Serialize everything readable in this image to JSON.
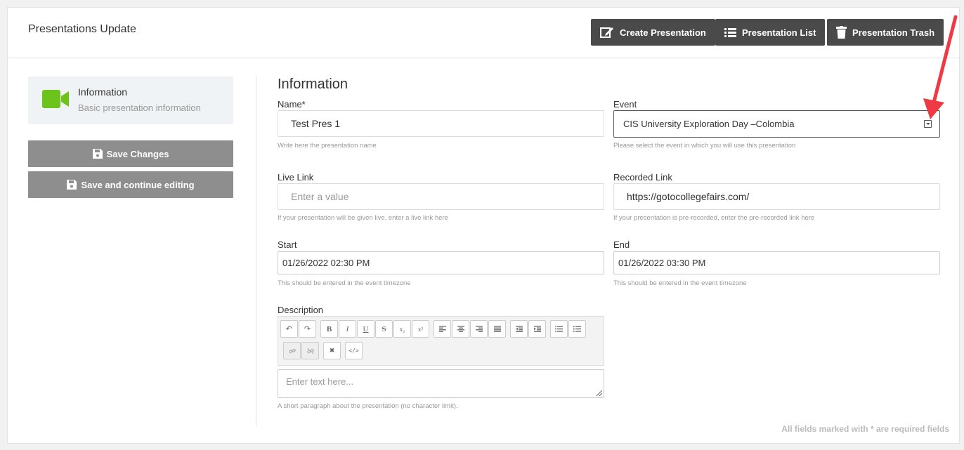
{
  "header": {
    "title": "Presentations Update",
    "buttons": {
      "create": "Create Presentation",
      "list": "Presentation List",
      "trash": "Presentation Trash"
    }
  },
  "sidebar": {
    "card_title": "Information",
    "card_subtitle": "Basic presentation information",
    "save_changes": "Save Changes",
    "save_continue": "Save and continue editing"
  },
  "form": {
    "section_title": "Information",
    "name": {
      "label": "Name*",
      "value": "Test Pres 1",
      "help": "Write here the presentation name"
    },
    "event": {
      "label": "Event",
      "value": "CIS University Exploration Day –Colombia",
      "help": "Please select the event in which you will use this presentation"
    },
    "live_link": {
      "label": "Live Link",
      "placeholder": "Enter a value",
      "help": "If your presentation will be given live, enter a live link here"
    },
    "recorded_link": {
      "label": "Recorded Link",
      "value": "https://gotocollegefairs.com/",
      "help": "If your presentation is pre-recorded, enter the pre-recorded link here"
    },
    "start": {
      "label": "Start",
      "value": "01/26/2022 02:30 PM",
      "help": "This should be entered in the event timezone"
    },
    "end": {
      "label": "End",
      "value": "01/26/2022 03:30 PM",
      "help": "This should be entered in the event timezone"
    },
    "description": {
      "label": "Description",
      "placeholder": "Enter text here...",
      "help": "A short paragraph about the presentation (no character limit)."
    }
  },
  "toolbar": {
    "undo": "↶",
    "redo": "↷",
    "bold": "B",
    "italic": "I",
    "underline": "U",
    "strike": "S",
    "subscript": "x₂",
    "superscript": "x²",
    "remove_format": "✖",
    "code": "</>"
  },
  "footer": {
    "required_note": "All fields marked with * are required fields"
  },
  "colors": {
    "accent_green": "#6cc31c",
    "dark_button": "#4a4a4a",
    "gray_button": "#8e8e8e",
    "arrow_red": "#ee3a43"
  }
}
